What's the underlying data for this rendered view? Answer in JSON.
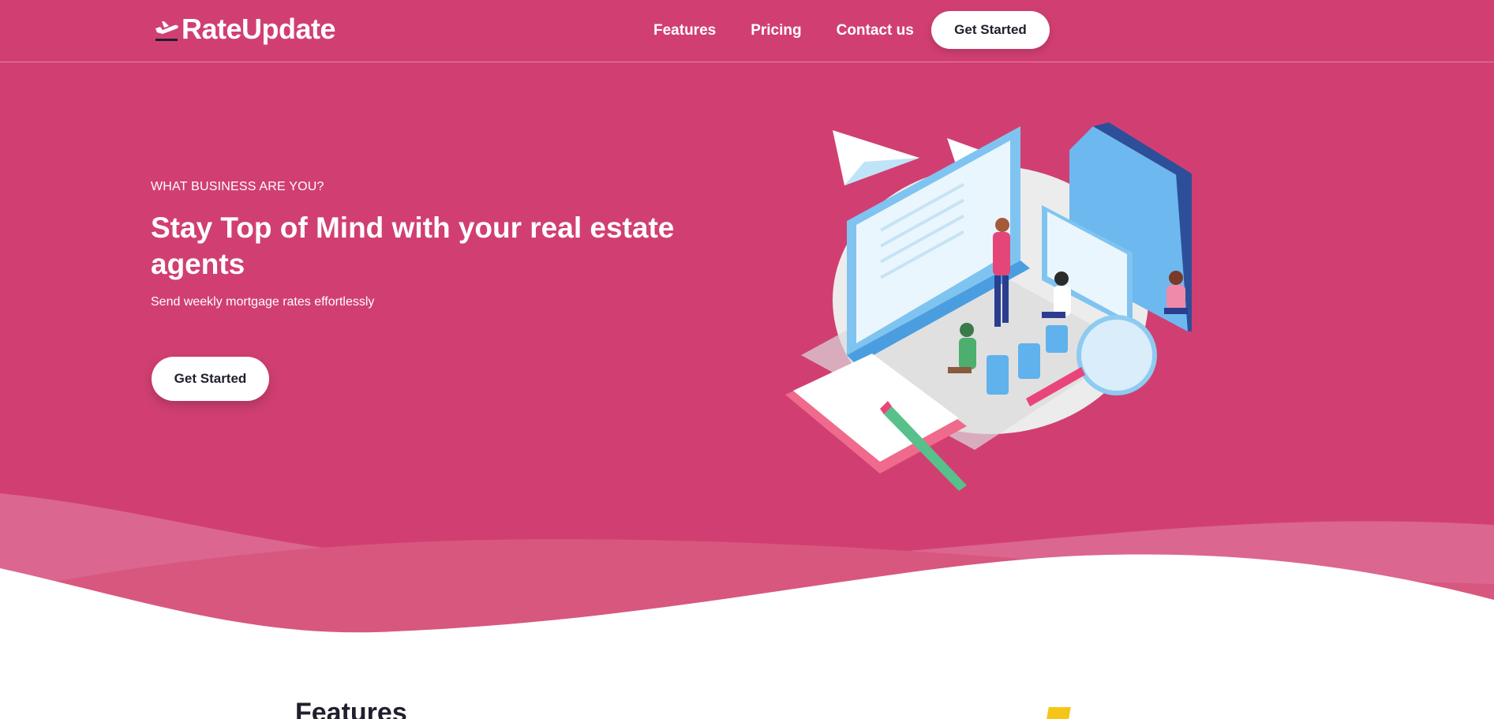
{
  "brand": {
    "name": "RateUpdate",
    "icon": "plane-departure-icon"
  },
  "nav": {
    "items": [
      "Features",
      "Pricing",
      "Contact us"
    ],
    "cta_label": "Get Started"
  },
  "hero": {
    "eyebrow": "WHAT BUSINESS ARE YOU?",
    "headline": "Stay Top of Mind with your real estate agents",
    "subtext": "Send weekly mortgage rates effortlessly",
    "cta_label": "Get Started"
  },
  "features": {
    "title": "Features"
  },
  "colors": {
    "hero_bg": "#d13f72",
    "wave_light": "#df7196",
    "wave_mid": "#d8577f",
    "button_bg": "#ffffff",
    "button_text": "#1f1f2e"
  }
}
